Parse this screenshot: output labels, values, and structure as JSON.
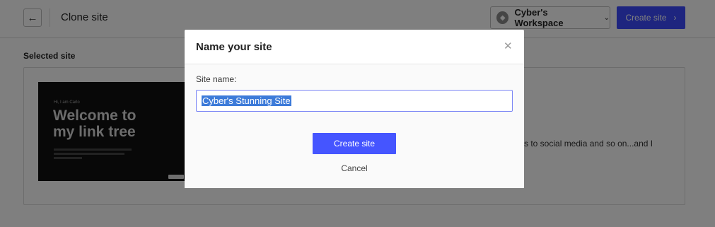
{
  "header": {
    "back_icon": "arrow-left-icon",
    "title": "Clone site",
    "workspace": {
      "name": "Cyber's Workspace",
      "logo_icon": "workspace-logo-icon",
      "chevron_icon": "chevron-down-icon"
    },
    "create_label": "Create site",
    "create_chevron_icon": "chevron-right-icon"
  },
  "selected_site": {
    "label": "Selected site",
    "thumbnail": {
      "greeting": "Hi, I am Carlo",
      "title_line1": "Welcome to",
      "title_line2": "my link tree"
    },
    "description": "s to social media and so on...and I"
  },
  "modal": {
    "title": "Name your site",
    "close_icon": "close-icon",
    "field_label": "Site name:",
    "site_name_value": "Cyber's Stunning Site",
    "create_label": "Create site",
    "cancel_label": "Cancel"
  },
  "colors": {
    "accent": "#4555ff",
    "header_button": "#3c4aff",
    "selection": "#3d7bd9",
    "overlay": "rgba(0,0,0,0.5)"
  }
}
